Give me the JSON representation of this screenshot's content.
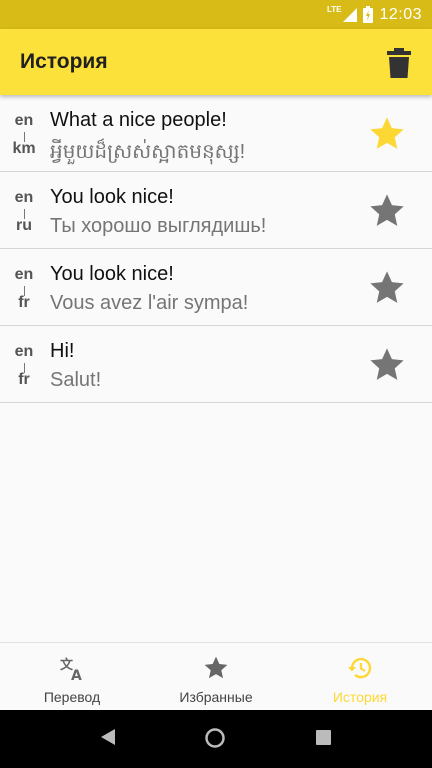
{
  "status_bar": {
    "time": "12:03",
    "network": "LTE"
  },
  "app_bar": {
    "title": "История",
    "clear_icon": "trash-icon"
  },
  "history": [
    {
      "src_lang": "en",
      "tgt_lang": "km",
      "source": "What a nice people!",
      "translation": "អ្វីមួយដ៏ស្រស់ស្អាតមនុស្ស!",
      "favorite": true
    },
    {
      "src_lang": "en",
      "tgt_lang": "ru",
      "source": "You look nice!",
      "translation": "Ты хорошо выглядишь!",
      "favorite": false
    },
    {
      "src_lang": "en",
      "tgt_lang": "fr",
      "source": "You look nice!",
      "translation": "Vous avez l'air sympa!",
      "favorite": false
    },
    {
      "src_lang": "en",
      "tgt_lang": "fr",
      "source": "Hi!",
      "translation": "Salut!",
      "favorite": false
    }
  ],
  "bottom_nav": {
    "items": [
      {
        "label": "Перевод",
        "icon": "translate-icon"
      },
      {
        "label": "Избранные",
        "icon": "star-icon"
      },
      {
        "label": "История",
        "icon": "history-icon"
      }
    ],
    "active_index": 2
  },
  "colors": {
    "accent": "#fdd835",
    "app_bar": "#fde13b",
    "status_bar": "#d8bb16",
    "star_inactive": "#757575",
    "star_active": "#fdd835"
  }
}
